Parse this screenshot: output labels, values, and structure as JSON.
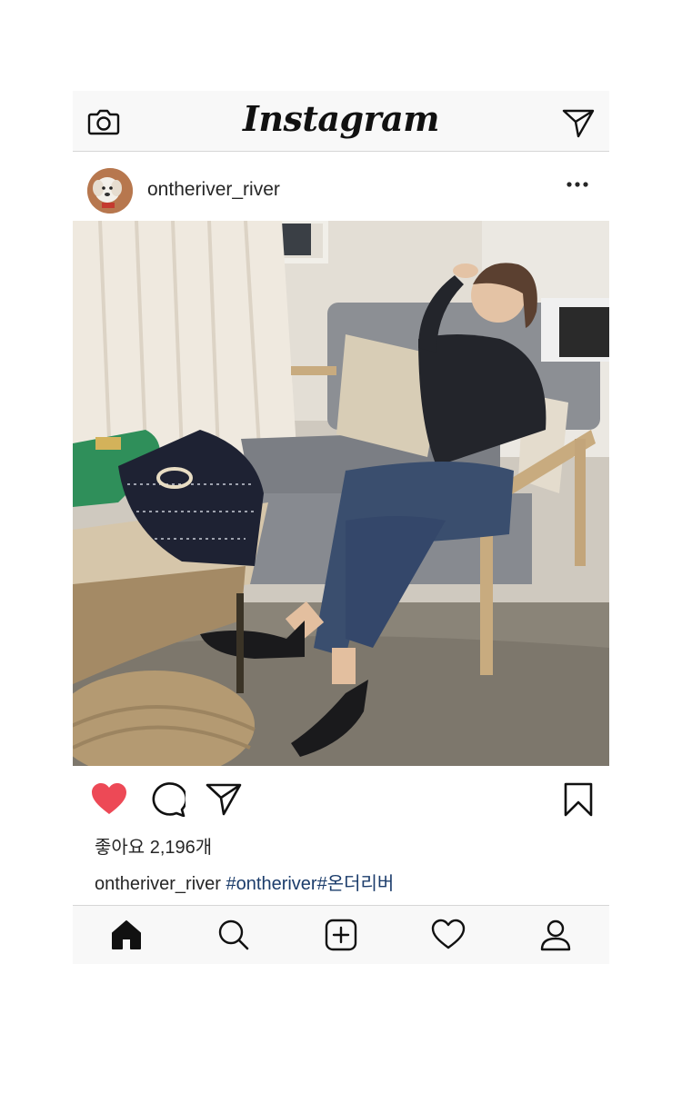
{
  "topbar": {
    "logo": "Instagram",
    "camera_icon": "camera-icon",
    "direct_icon": "paper-plane-icon"
  },
  "post": {
    "username": "ontheriver_river",
    "more_icon": "more-dots-icon",
    "likes_text": "좋아요 2,196개",
    "caption_user": "ontheriver_river",
    "caption_tags": "#ontheriver#온더리버"
  },
  "actions": {
    "like_icon": "heart-filled-icon",
    "comment_icon": "comment-icon",
    "share_icon": "paper-plane-icon",
    "save_icon": "bookmark-icon"
  },
  "nav": [
    "home-icon",
    "search-icon",
    "add-icon",
    "heart-icon",
    "profile-icon"
  ],
  "colors": {
    "like_red": "#ed4956",
    "hashtag_blue": "#1b3c6b",
    "bar_bg": "#f8f8f8"
  }
}
